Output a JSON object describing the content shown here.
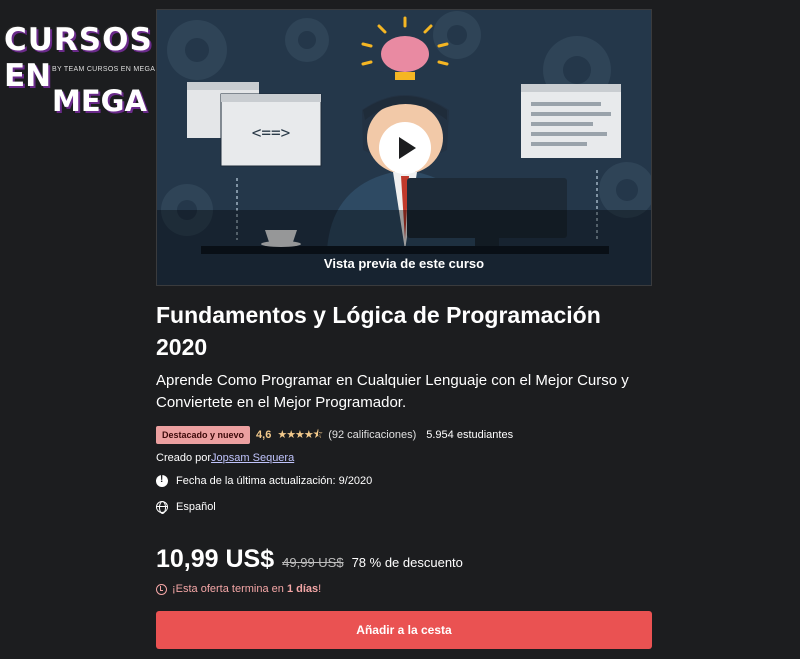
{
  "watermark": {
    "line1": "CURSOS",
    "line2": "EN",
    "byline": "BY TEAM CURSOS EN MEGA",
    "line3": "MEGA"
  },
  "preview": {
    "label": "Vista previa de este curso",
    "code_symbol": "<==>"
  },
  "course": {
    "title": "Fundamentos y Lógica de Programación 2020",
    "subtitle": "Aprende Como Programar en Cualquier Lenguaje con el Mejor Curso y Conviertete en el Mejor Programador.",
    "badge": "Destacado y nuevo",
    "rating": "4,6",
    "stars": "★★★★⯪",
    "rating_value": 4.6,
    "ratings_count": "(92 calificaciones)",
    "students": "5.954 estudiantes",
    "created_prefix": "Creado por",
    "author": "Jopsam Sequera",
    "updated": "Fecha de la última actualización: 9/2020",
    "language": "Español"
  },
  "pricing": {
    "price": "10,99 US$",
    "old_price": "49,99 US$",
    "discount": "78 % de descuento",
    "offer_prefix": "¡Esta oferta termina en ",
    "offer_days": "1 días",
    "offer_suffix": "!",
    "cart_button": "Añadir a la cesta"
  },
  "colors": {
    "background": "#1c1d1f",
    "badge": "#eca0a0",
    "rating": "#f3ca8c",
    "cta": "#ea5252",
    "link": "#c0c4fc"
  }
}
